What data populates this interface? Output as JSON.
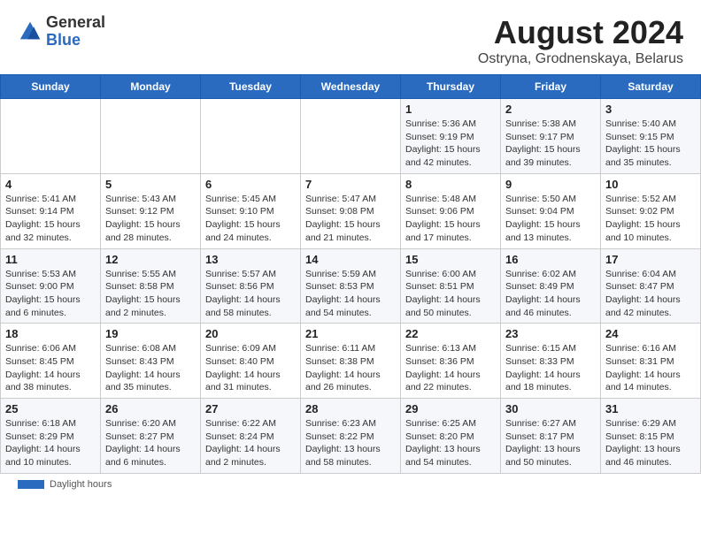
{
  "header": {
    "title": "August 2024",
    "subtitle": "Ostryna, Grodnenskaya, Belarus",
    "logo_general": "General",
    "logo_blue": "Blue"
  },
  "weekdays": [
    "Sunday",
    "Monday",
    "Tuesday",
    "Wednesday",
    "Thursday",
    "Friday",
    "Saturday"
  ],
  "weeks": [
    [
      {
        "day": "",
        "info": ""
      },
      {
        "day": "",
        "info": ""
      },
      {
        "day": "",
        "info": ""
      },
      {
        "day": "",
        "info": ""
      },
      {
        "day": "1",
        "info": "Sunrise: 5:36 AM\nSunset: 9:19 PM\nDaylight: 15 hours\nand 42 minutes."
      },
      {
        "day": "2",
        "info": "Sunrise: 5:38 AM\nSunset: 9:17 PM\nDaylight: 15 hours\nand 39 minutes."
      },
      {
        "day": "3",
        "info": "Sunrise: 5:40 AM\nSunset: 9:15 PM\nDaylight: 15 hours\nand 35 minutes."
      }
    ],
    [
      {
        "day": "4",
        "info": "Sunrise: 5:41 AM\nSunset: 9:14 PM\nDaylight: 15 hours\nand 32 minutes."
      },
      {
        "day": "5",
        "info": "Sunrise: 5:43 AM\nSunset: 9:12 PM\nDaylight: 15 hours\nand 28 minutes."
      },
      {
        "day": "6",
        "info": "Sunrise: 5:45 AM\nSunset: 9:10 PM\nDaylight: 15 hours\nand 24 minutes."
      },
      {
        "day": "7",
        "info": "Sunrise: 5:47 AM\nSunset: 9:08 PM\nDaylight: 15 hours\nand 21 minutes."
      },
      {
        "day": "8",
        "info": "Sunrise: 5:48 AM\nSunset: 9:06 PM\nDaylight: 15 hours\nand 17 minutes."
      },
      {
        "day": "9",
        "info": "Sunrise: 5:50 AM\nSunset: 9:04 PM\nDaylight: 15 hours\nand 13 minutes."
      },
      {
        "day": "10",
        "info": "Sunrise: 5:52 AM\nSunset: 9:02 PM\nDaylight: 15 hours\nand 10 minutes."
      }
    ],
    [
      {
        "day": "11",
        "info": "Sunrise: 5:53 AM\nSunset: 9:00 PM\nDaylight: 15 hours\nand 6 minutes."
      },
      {
        "day": "12",
        "info": "Sunrise: 5:55 AM\nSunset: 8:58 PM\nDaylight: 15 hours\nand 2 minutes."
      },
      {
        "day": "13",
        "info": "Sunrise: 5:57 AM\nSunset: 8:56 PM\nDaylight: 14 hours\nand 58 minutes."
      },
      {
        "day": "14",
        "info": "Sunrise: 5:59 AM\nSunset: 8:53 PM\nDaylight: 14 hours\nand 54 minutes."
      },
      {
        "day": "15",
        "info": "Sunrise: 6:00 AM\nSunset: 8:51 PM\nDaylight: 14 hours\nand 50 minutes."
      },
      {
        "day": "16",
        "info": "Sunrise: 6:02 AM\nSunset: 8:49 PM\nDaylight: 14 hours\nand 46 minutes."
      },
      {
        "day": "17",
        "info": "Sunrise: 6:04 AM\nSunset: 8:47 PM\nDaylight: 14 hours\nand 42 minutes."
      }
    ],
    [
      {
        "day": "18",
        "info": "Sunrise: 6:06 AM\nSunset: 8:45 PM\nDaylight: 14 hours\nand 38 minutes."
      },
      {
        "day": "19",
        "info": "Sunrise: 6:08 AM\nSunset: 8:43 PM\nDaylight: 14 hours\nand 35 minutes."
      },
      {
        "day": "20",
        "info": "Sunrise: 6:09 AM\nSunset: 8:40 PM\nDaylight: 14 hours\nand 31 minutes."
      },
      {
        "day": "21",
        "info": "Sunrise: 6:11 AM\nSunset: 8:38 PM\nDaylight: 14 hours\nand 26 minutes."
      },
      {
        "day": "22",
        "info": "Sunrise: 6:13 AM\nSunset: 8:36 PM\nDaylight: 14 hours\nand 22 minutes."
      },
      {
        "day": "23",
        "info": "Sunrise: 6:15 AM\nSunset: 8:33 PM\nDaylight: 14 hours\nand 18 minutes."
      },
      {
        "day": "24",
        "info": "Sunrise: 6:16 AM\nSunset: 8:31 PM\nDaylight: 14 hours\nand 14 minutes."
      }
    ],
    [
      {
        "day": "25",
        "info": "Sunrise: 6:18 AM\nSunset: 8:29 PM\nDaylight: 14 hours\nand 10 minutes."
      },
      {
        "day": "26",
        "info": "Sunrise: 6:20 AM\nSunset: 8:27 PM\nDaylight: 14 hours\nand 6 minutes."
      },
      {
        "day": "27",
        "info": "Sunrise: 6:22 AM\nSunset: 8:24 PM\nDaylight: 14 hours\nand 2 minutes."
      },
      {
        "day": "28",
        "info": "Sunrise: 6:23 AM\nSunset: 8:22 PM\nDaylight: 13 hours\nand 58 minutes."
      },
      {
        "day": "29",
        "info": "Sunrise: 6:25 AM\nSunset: 8:20 PM\nDaylight: 13 hours\nand 54 minutes."
      },
      {
        "day": "30",
        "info": "Sunrise: 6:27 AM\nSunset: 8:17 PM\nDaylight: 13 hours\nand 50 minutes."
      },
      {
        "day": "31",
        "info": "Sunrise: 6:29 AM\nSunset: 8:15 PM\nDaylight: 13 hours\nand 46 minutes."
      }
    ]
  ],
  "footer": {
    "daylight_label": "Daylight hours"
  }
}
